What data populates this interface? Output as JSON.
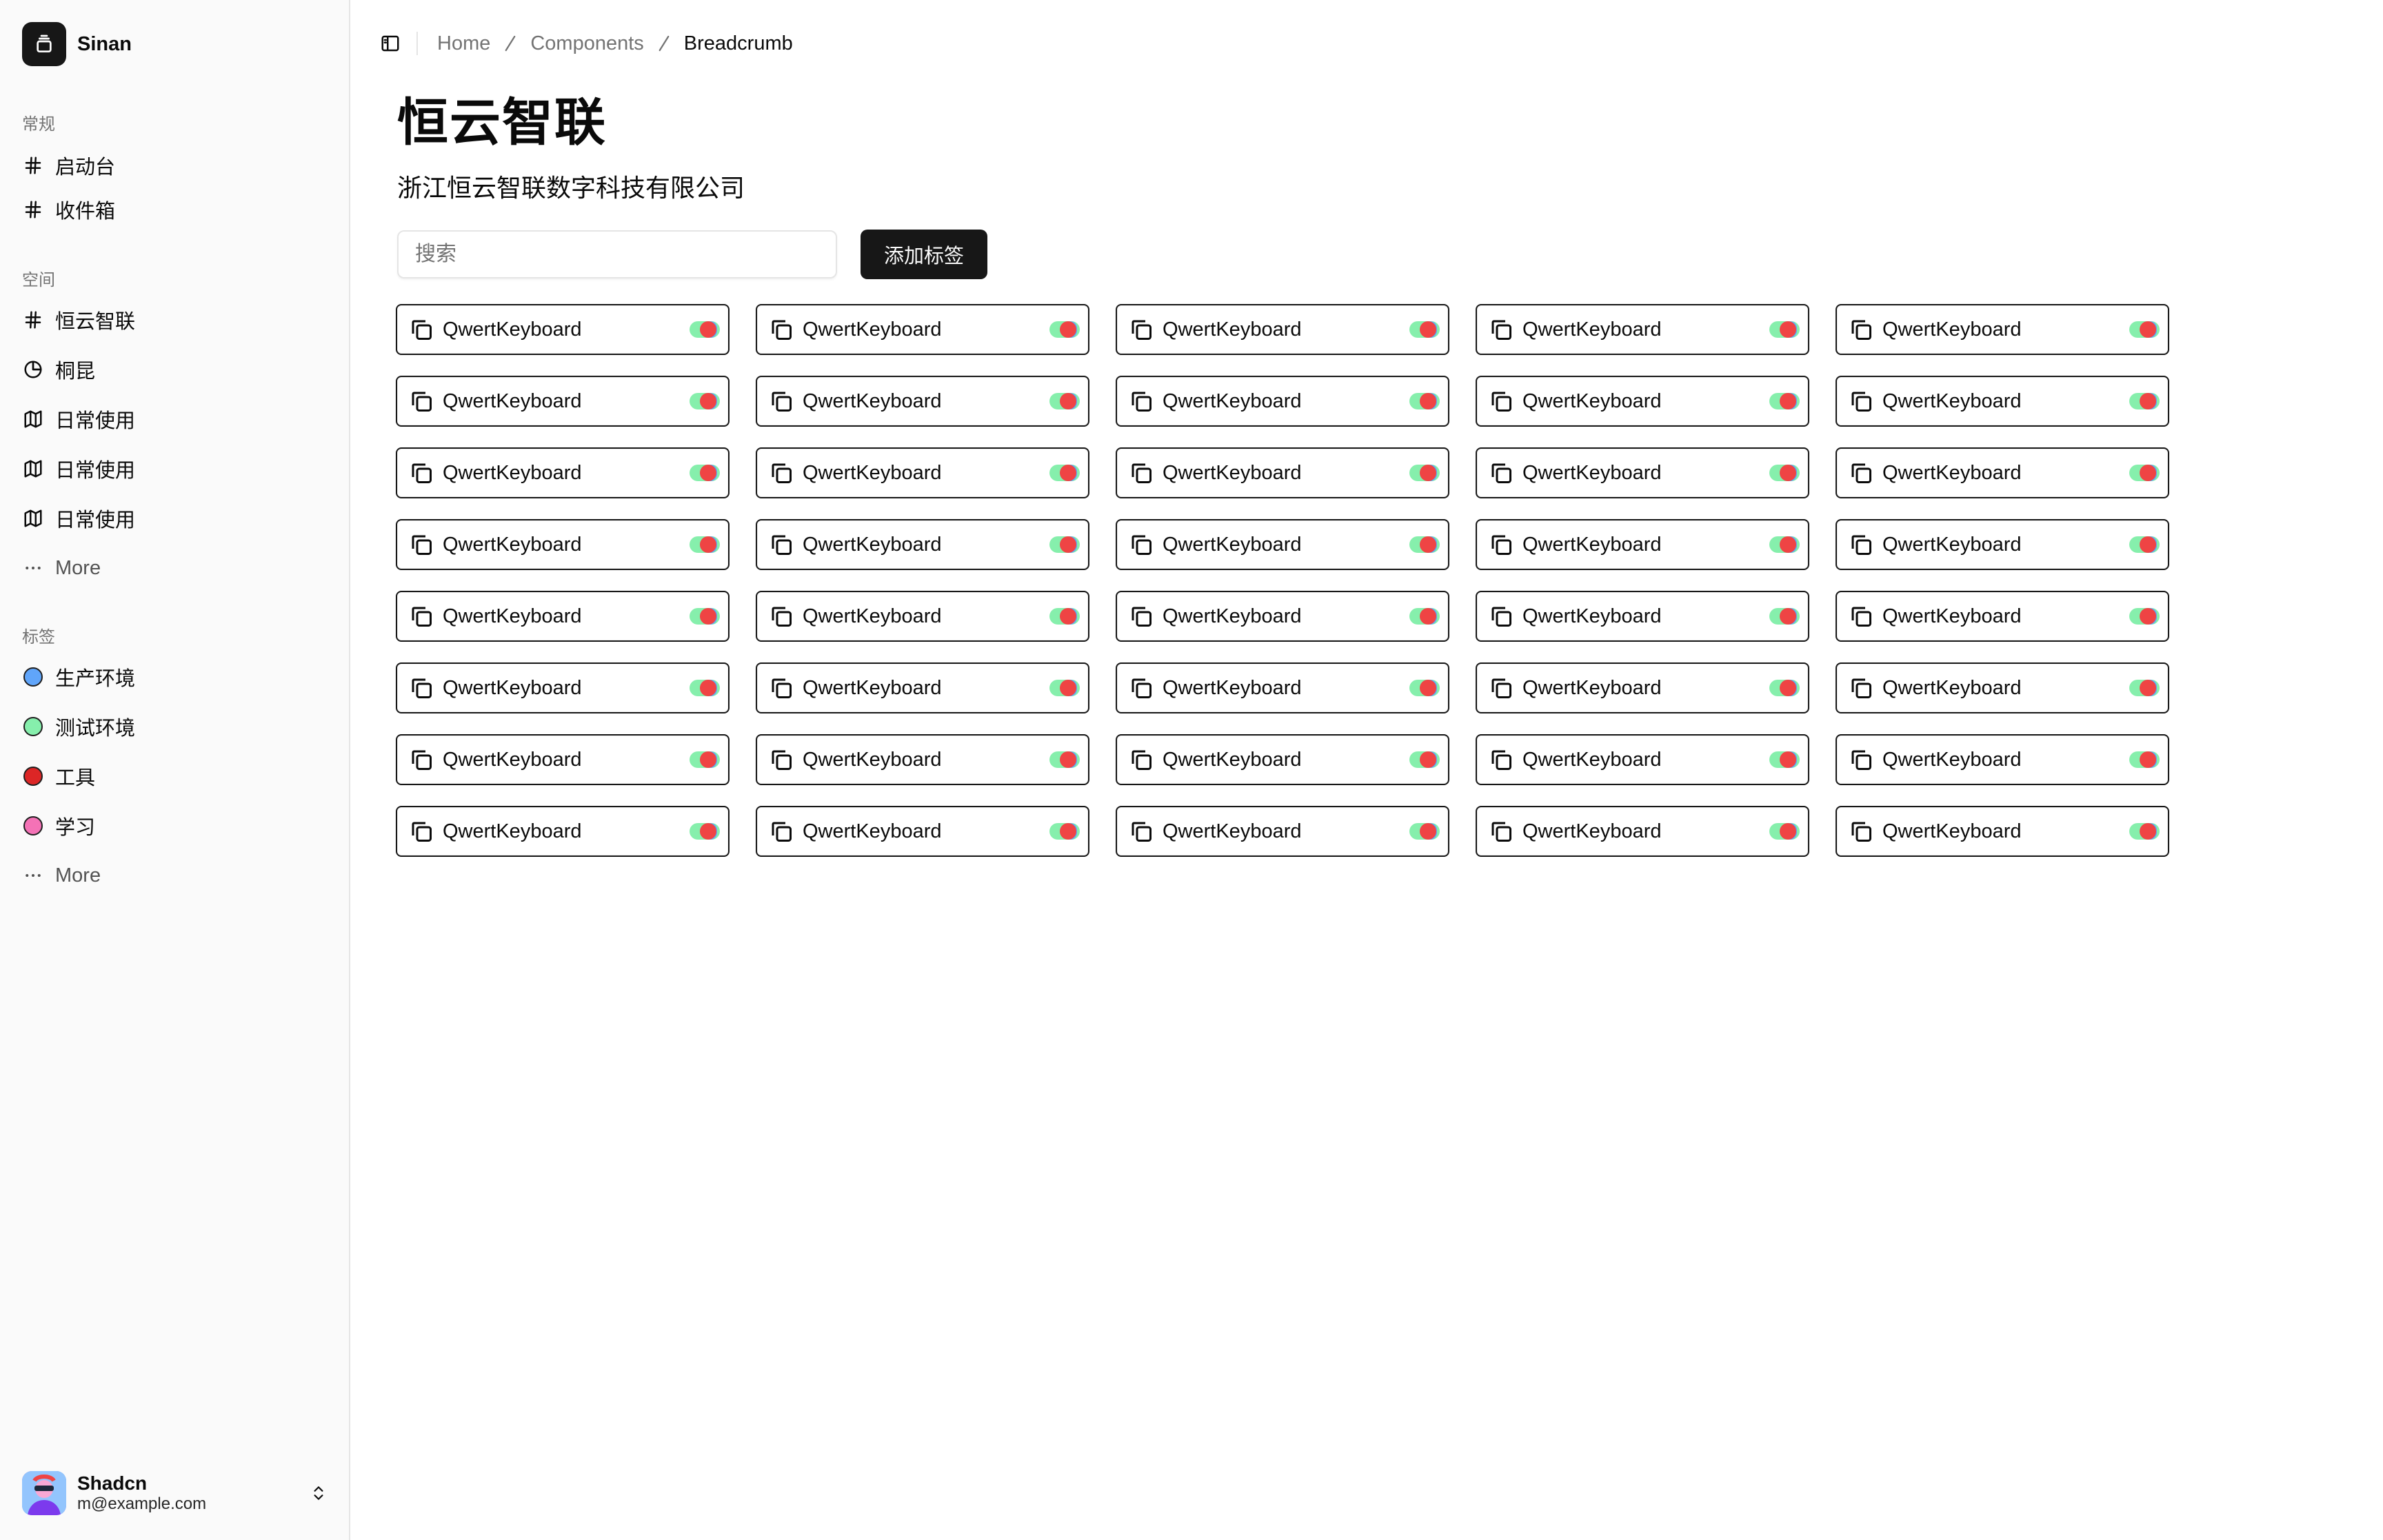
{
  "sidebar": {
    "brand": {
      "name": "Sinan",
      "icon": "layers-icon"
    },
    "groups": [
      {
        "label": "常规",
        "items": [
          {
            "label": "启动台",
            "icon": "hash-icon"
          },
          {
            "label": "收件箱",
            "icon": "hash-icon"
          }
        ]
      },
      {
        "label": "空间",
        "items": [
          {
            "label": "恒云智联",
            "icon": "hash-icon"
          },
          {
            "label": "桐昆",
            "icon": "pie-chart-icon"
          },
          {
            "label": "日常使用",
            "icon": "map-icon"
          },
          {
            "label": "日常使用",
            "icon": "map-icon"
          },
          {
            "label": "日常使用",
            "icon": "map-icon"
          }
        ],
        "more": "More"
      },
      {
        "label": "标签",
        "items": [
          {
            "label": "生产环境",
            "color": "#60a5fa"
          },
          {
            "label": "测试环境",
            "color": "#86efac"
          },
          {
            "label": "工具",
            "color": "#dc2626"
          },
          {
            "label": "学习",
            "color": "#f472b6"
          }
        ],
        "more": "More"
      }
    ],
    "user": {
      "name": "Shadcn",
      "email": "m@example.com"
    }
  },
  "breadcrumb": [
    "Home",
    "Components",
    "Breadcrumb"
  ],
  "page": {
    "title": "恒云智联",
    "subtitle": "浙江恒云智联数字科技有限公司"
  },
  "search": {
    "placeholder": "搜索",
    "value": ""
  },
  "add_button": "添加标签",
  "tags": {
    "label": "QwertKeyboard",
    "icon": "copy-icon",
    "count": 40,
    "switch_colors": {
      "track": "#86efac",
      "knob": "#ef4444",
      "accent": "#60a5fa"
    }
  }
}
